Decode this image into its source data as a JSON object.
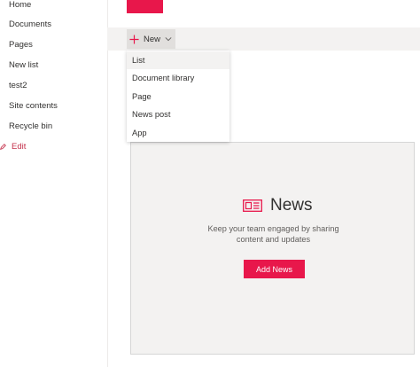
{
  "nav": {
    "items": [
      {
        "label": "Home"
      },
      {
        "label": "Documents"
      },
      {
        "label": "Pages"
      },
      {
        "label": "New list"
      },
      {
        "label": "test2"
      },
      {
        "label": "Site contents"
      },
      {
        "label": "Recycle bin"
      }
    ],
    "edit_label": "Edit",
    "edit_icon": "pencil-icon"
  },
  "command_bar": {
    "new_label": "New",
    "new_icon": "plus-icon",
    "chevron_icon": "chevron-down-icon"
  },
  "new_menu": {
    "items": [
      {
        "label": "List"
      },
      {
        "label": "Document library"
      },
      {
        "label": "Page"
      },
      {
        "label": "News post"
      },
      {
        "label": "App"
      }
    ]
  },
  "news_webpart": {
    "icon": "news-icon",
    "title": "News",
    "description_line1": "Keep your team engaged by sharing",
    "description_line2": "content and updates",
    "button_label": "Add News"
  },
  "colors": {
    "accent": "#e8174b",
    "edit_text": "#c4314b",
    "command_bar_bg": "#f3f2f1",
    "card_bg": "#f3f2f1"
  }
}
